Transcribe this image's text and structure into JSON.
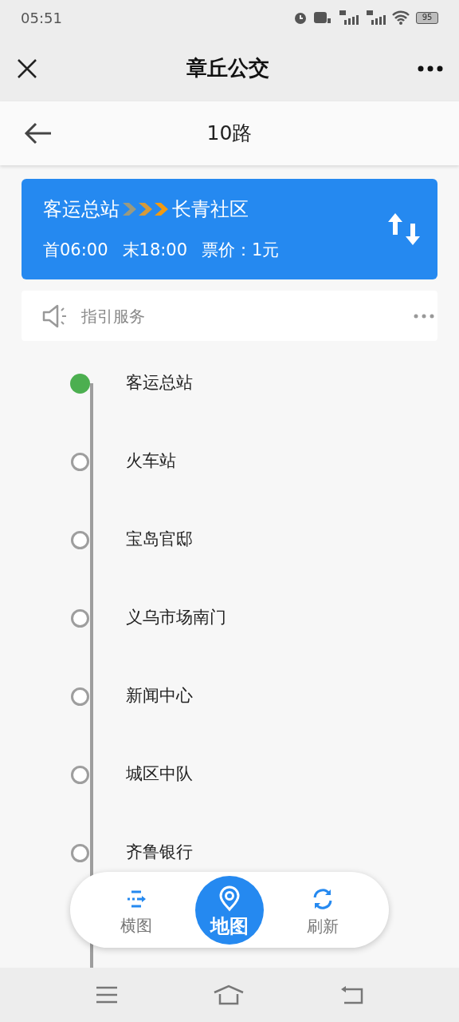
{
  "status_bar": {
    "time": "05:51",
    "battery": "95"
  },
  "header": {
    "title": "章丘公交"
  },
  "subheader": {
    "title": "10路"
  },
  "route": {
    "from": "客运总站",
    "to": "长青社区",
    "first": "首06:00",
    "last": "末18:00",
    "fare": "票价：1元"
  },
  "guide": {
    "label": "指引服务"
  },
  "stops": [
    {
      "name": "客运总站",
      "current": true
    },
    {
      "name": "火车站",
      "current": false
    },
    {
      "name": "宝岛官邸",
      "current": false
    },
    {
      "name": "义乌市场南门",
      "current": false
    },
    {
      "name": "新闻中心",
      "current": false
    },
    {
      "name": "城区中队",
      "current": false
    },
    {
      "name": "齐鲁银行",
      "current": false
    }
  ],
  "bottom_tabs": [
    {
      "kind": "lines",
      "label": "横图",
      "selected": false
    },
    {
      "kind": "map",
      "label": "地图",
      "selected": true
    },
    {
      "kind": "refresh",
      "label": "刷新",
      "selected": false
    }
  ]
}
